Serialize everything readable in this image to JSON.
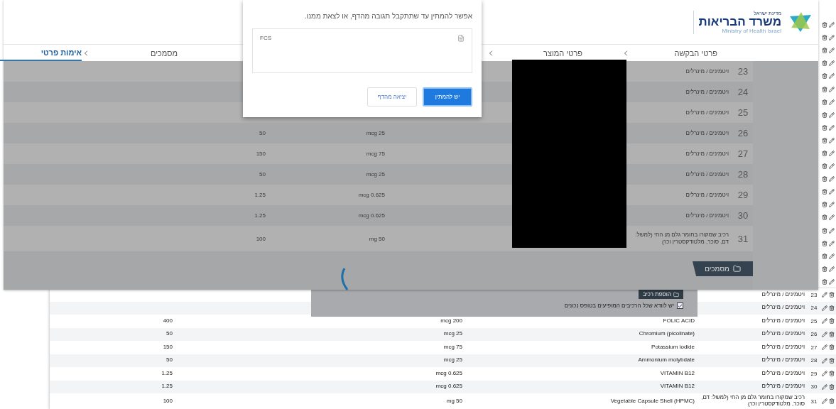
{
  "back_page": {
    "panel": {
      "add_button": "הוספת רכיב",
      "confirm": {
        "label": "יש לוודא שכל הרכיבים המופיעים בטופס נכונים",
        "checked": true
      }
    },
    "rows": [
      {
        "number": "23",
        "category": "ויטמינים / מינרלים"
      },
      {
        "number": "24",
        "category": "ויטמינים / מינרלים"
      },
      {
        "number": "25",
        "category": "ויטמינים / מינרלים",
        "name": "FOLIC ACID",
        "amount": "mcg 200",
        "value": "400"
      },
      {
        "number": "26",
        "category": "ויטמינים / מינרלים",
        "name": "Chromium (picolinate)",
        "amount": "mcg 25",
        "value": "50"
      },
      {
        "number": "27",
        "category": "ויטמינים / מינרלים",
        "name": "Potassium iodide",
        "amount": "mcg 75",
        "value": "150"
      },
      {
        "number": "28",
        "category": "ויטמינים / מינרלים",
        "name": "Ammonium molybdate",
        "amount": "mcg 25",
        "value": "50"
      },
      {
        "number": "29",
        "category": "ויטמינים / מינרלים",
        "name": "VITAMIN B12",
        "amount": "mcg 0.625",
        "value": "1.25"
      },
      {
        "number": "30",
        "category": "ויטמינים / מינרלים",
        "name": "VITAMIN B12",
        "amount": "mcg 0.625",
        "value": "1.25"
      },
      {
        "number": "31",
        "category": "רכיב שמקורו בחומר גלם מן החי (למשל: דם, סוכר, מלטודקסטרין וכו')",
        "name": "Vegetable Capsule Shell (HPMC)",
        "amount": "mg 50",
        "value": "100"
      }
    ]
  },
  "overlay": {
    "logo": {
      "state": "מדינת ישראל",
      "ministry": "משרד הבריאות",
      "english": "Ministry of Health Israel"
    },
    "tabs": [
      {
        "label": "פרטי הבקשה",
        "selected": false
      },
      {
        "label": "פרטי המוצר",
        "selected": false
      },
      {
        "label": "מסמכים",
        "selected": false
      },
      {
        "label": "אימות פרטי",
        "selected": true
      }
    ],
    "rows": [
      {
        "number": "23",
        "category": "ויטמינים / מינרלים"
      },
      {
        "number": "24",
        "category": "ויטמינים / מינרלים"
      },
      {
        "number": "25",
        "category": "ויטמינים / מינרלים"
      },
      {
        "number": "26",
        "category": "ויטמינים / מינרלים",
        "amount": "mcg 25",
        "value": "50"
      },
      {
        "number": "27",
        "category": "ויטמינים / מינרלים",
        "amount": "mcg 75",
        "value": "150"
      },
      {
        "number": "28",
        "category": "ויטמינים / מינרלים",
        "amount": "mcg 25",
        "value": "50"
      },
      {
        "number": "29",
        "category": "ויטמינים / מינרלים",
        "amount": "mcg 0.625",
        "value": "1.25"
      },
      {
        "number": "30",
        "category": "ויטמינים / מינרלים",
        "amount": "mcg 0.625",
        "value": "1.25"
      },
      {
        "number": "31",
        "category": "רכיב שמקורו בחומר גלם מן החי (למשל: דם, סוכר, מלטודקסטרין וכו')",
        "amount": "mg 50",
        "value": "100"
      }
    ],
    "documents_button": "מסמכים"
  },
  "dialog": {
    "message": "אפשר להמתין עד שתתקבל תגובה מהדף, או לצאת ממנו.",
    "field_value": "FCS",
    "buttons": [
      {
        "label": "יש להמתין",
        "kind": "primary"
      },
      {
        "label": "יציאה מהדף",
        "kind": "secondary"
      }
    ]
  }
}
